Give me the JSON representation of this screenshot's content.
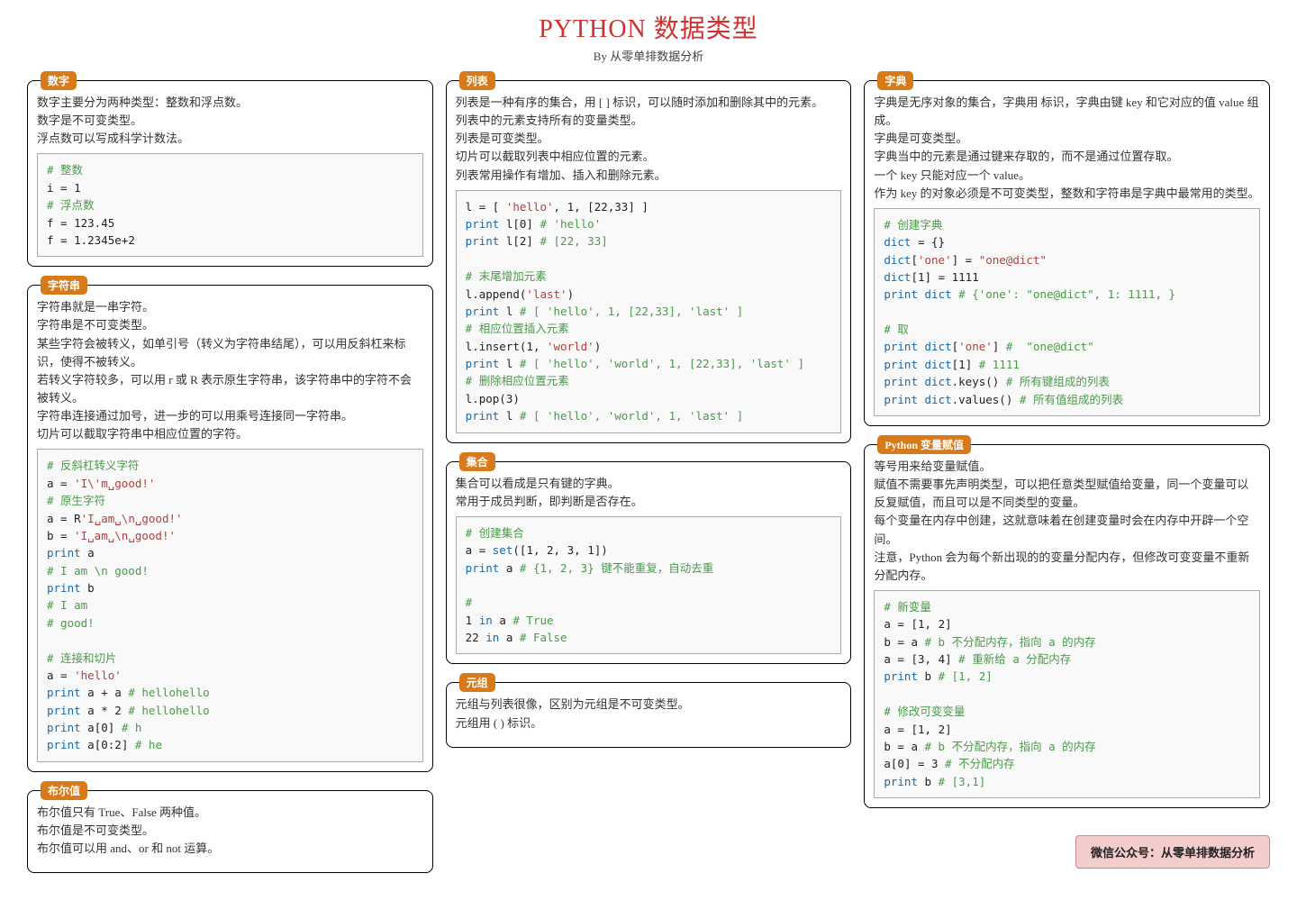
{
  "title": "PYTHON 数据类型",
  "subtitle": "By 从零单排数据分析",
  "footer": "微信公众号：从零单排数据分析",
  "cards": {
    "number": {
      "label": "数字",
      "desc": "数字主要分为两种类型：整数和浮点数。\n数字是不可变类型。\n浮点数可以写成科学计数法。"
    },
    "string": {
      "label": "字符串",
      "desc": "字符串就是一串字符。\n字符串是不可变类型。\n某些字符会被转义，如单引号（转义为字符串结尾），可以用反斜杠来标识，使得不被转义。\n若转义字符较多，可以用 r 或 R 表示原生字符串，该字符串中的字符不会被转义。\n字符串连接通过加号，进一步的可以用乘号连接同一字符串。\n切片可以截取字符串中相应位置的字符。"
    },
    "bool": {
      "label": "布尔值",
      "desc": "布尔值只有 True、False 两种值。\n布尔值是不可变类型。\n布尔值可以用 and、or 和 not 运算。"
    },
    "list": {
      "label": "列表",
      "desc": "列表是一种有序的集合，用 [ ] 标识，可以随时添加和删除其中的元素。\n列表中的元素支持所有的变量类型。\n列表是可变类型。\n切片可以截取列表中相应位置的元素。\n列表常用操作有增加、插入和删除元素。"
    },
    "set": {
      "label": "集合",
      "desc": "集合可以看成是只有键的字典。\n常用于成员判断，即判断是否存在。"
    },
    "tuple": {
      "label": "元组",
      "desc": "元组与列表很像，区别为元组是不可变类型。\n元组用 ( ) 标识。"
    },
    "dict": {
      "label": "字典",
      "desc": "字典是无序对象的集合，字典用  标识，字典由键 key 和它对应的值 value 组成。\n字典是可变类型。\n字典当中的元素是通过键来存取的，而不是通过位置存取。\n一个 key 只能对应一个 value。\n作为 key 的对象必须是不可变类型，整数和字符串是字典中最常用的类型。"
    },
    "assign": {
      "label": "Python 变量赋值",
      "desc": "等号用来给变量赋值。\n赋值不需要事先声明类型，可以把任意类型赋值给变量，同一个变量可以反复赋值，而且可以是不同类型的变量。\n每个变量在内存中创建，这就意味着在创建变量时会在内存中开辟一个空间。\n注意，Python 会为每个新出现的的变量分配内存，但修改可变变量不重新分配内存。"
    }
  }
}
